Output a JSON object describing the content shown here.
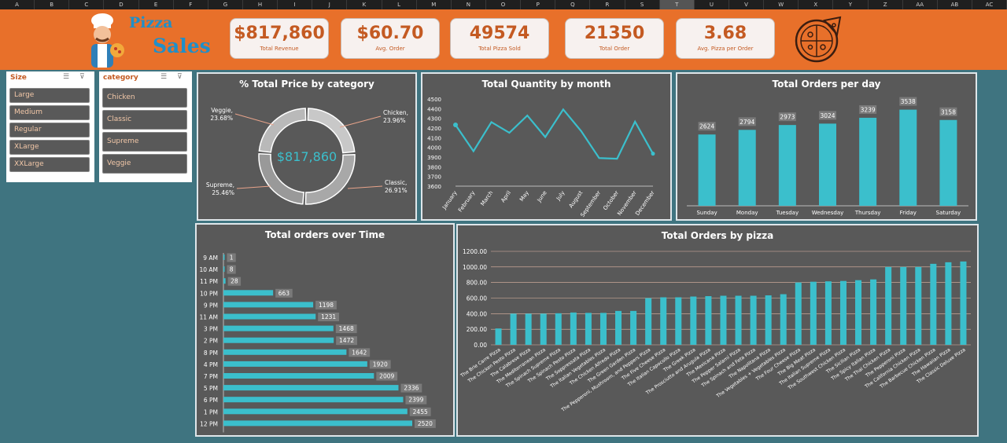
{
  "spreadsheet": {
    "columns": [
      "A",
      "B",
      "C",
      "D",
      "E",
      "F",
      "G",
      "H",
      "I",
      "J",
      "K",
      "L",
      "M",
      "N",
      "O",
      "P",
      "Q",
      "R",
      "S",
      "T",
      "U",
      "V",
      "W",
      "X",
      "Y",
      "Z",
      "AA",
      "AB",
      "AC"
    ],
    "selected_column": "T"
  },
  "header": {
    "title_line1": "Pizza",
    "title_line2": "Sales"
  },
  "kpis": [
    {
      "value": "$817,860",
      "label": "Total Revenue"
    },
    {
      "value": "$60.70",
      "label": "Avg. Order"
    },
    {
      "value": "49574",
      "label": "Total Pizza Sold"
    },
    {
      "value": "21350",
      "label": "Total Order"
    },
    {
      "value": "3.68",
      "label": "Avg. Pizza per Order"
    }
  ],
  "slicers": {
    "size": {
      "title": "Size",
      "items": [
        "Large",
        "Medium",
        "Regular",
        "XLarge",
        "XXLarge"
      ]
    },
    "category": {
      "title": "category",
      "items": [
        "Chicken",
        "Classic",
        "Supreme",
        "Veggie"
      ]
    }
  },
  "colors": {
    "accent": "#3bbfcc",
    "banner": "#e8702a",
    "panel": "#595959",
    "kpi_text": "#c45a22"
  },
  "chart_data": [
    {
      "type": "pie",
      "title": "% Total Price by category",
      "center_label": "$817,860",
      "labels": [
        "Chicken",
        "Classic",
        "Supreme",
        "Veggie"
      ],
      "values": [
        23.96,
        26.91,
        25.46,
        23.68
      ],
      "label_texts": [
        "23.96%",
        "26.91%",
        "25.46%",
        "23.68%"
      ]
    },
    {
      "type": "line",
      "title": "Total Quantity by month",
      "categories": [
        "January",
        "February",
        "March",
        "April",
        "May",
        "June",
        "July",
        "August",
        "September",
        "October",
        "November",
        "December"
      ],
      "values": [
        4232,
        3961,
        4261,
        4151,
        4329,
        4107,
        4392,
        4168,
        3890,
        3883,
        4266,
        3935
      ],
      "ylim": [
        3600,
        4500
      ],
      "yticks": [
        "3600",
        "3700",
        "3800",
        "3900",
        "4000",
        "4100",
        "4200",
        "4300",
        "4400",
        "4500"
      ]
    },
    {
      "type": "bar",
      "title": "Total Orders per day",
      "categories": [
        "Sunday",
        "Monday",
        "Tuesday",
        "Wednesday",
        "Thursday",
        "Friday",
        "Saturday"
      ],
      "values": [
        2624,
        2794,
        2973,
        3024,
        3239,
        3538,
        3158
      ]
    },
    {
      "type": "bar",
      "orientation": "horizontal",
      "title": "Total orders over Time",
      "categories": [
        "9 AM",
        "10 AM",
        "11 PM",
        "10 PM",
        "9 PM",
        "11 AM",
        "3 PM",
        "2 PM",
        "8 PM",
        "4 PM",
        "7 PM",
        "5 PM",
        "6 PM",
        "1 PM",
        "12 PM"
      ],
      "values": [
        1,
        8,
        28,
        663,
        1198,
        1231,
        1468,
        1472,
        1642,
        1920,
        2009,
        2336,
        2399,
        2455,
        2520
      ]
    },
    {
      "type": "bar",
      "title": "Total Orders by pizza",
      "categories": [
        "The Brie Carre Pizza",
        "The Chicken Pesto Pizza",
        "The Calabrese Pizza",
        "The Mediterranean Pizza",
        "The Spinach Supreme Pizza",
        "The Spinach Pesto Pizza",
        "The Soppressata Pizza",
        "The Italian Vegetables Pizza",
        "The Chicken Alfredo Pizza",
        "The Green Garden Pizza",
        "The Pepperoni, Mushroom, and Peppers Pizza",
        "The Five Cheese Pizza",
        "The Italian Capocollo Pizza",
        "The Greek Pizza",
        "The Prosciutto and Arugula Pizza",
        "The Mexicana Pizza",
        "The Pepper Salami Pizza",
        "The Spinach and Feta Pizza",
        "The Napolitana Pizza",
        "The Vegetables + Vegetables Pizza",
        "The Four Cheese Pizza",
        "The Big Meat Pizza",
        "The Italian Supreme Pizza",
        "The Southwest Chicken Pizza",
        "The Sicilian Pizza",
        "The Spicy Italian Pizza",
        "The Thai Chicken Pizza",
        "The Pepperoni Pizza",
        "The California Chicken Pizza",
        "The Barbecue Chicken Pizza",
        "The Hawaiian Pizza",
        "The Classic Deluxe Pizza"
      ],
      "values": [
        210,
        400,
        400,
        400,
        405,
        415,
        410,
        410,
        435,
        435,
        600,
        610,
        610,
        620,
        625,
        630,
        630,
        630,
        635,
        650,
        800,
        810,
        815,
        820,
        830,
        840,
        1000,
        1000,
        1000,
        1040,
        1060,
        1070
      ],
      "ylim": [
        0,
        1200
      ],
      "yticks": [
        "0.00",
        "200.00",
        "400.00",
        "600.00",
        "800.00",
        "1000.00",
        "1200.00"
      ]
    }
  ]
}
